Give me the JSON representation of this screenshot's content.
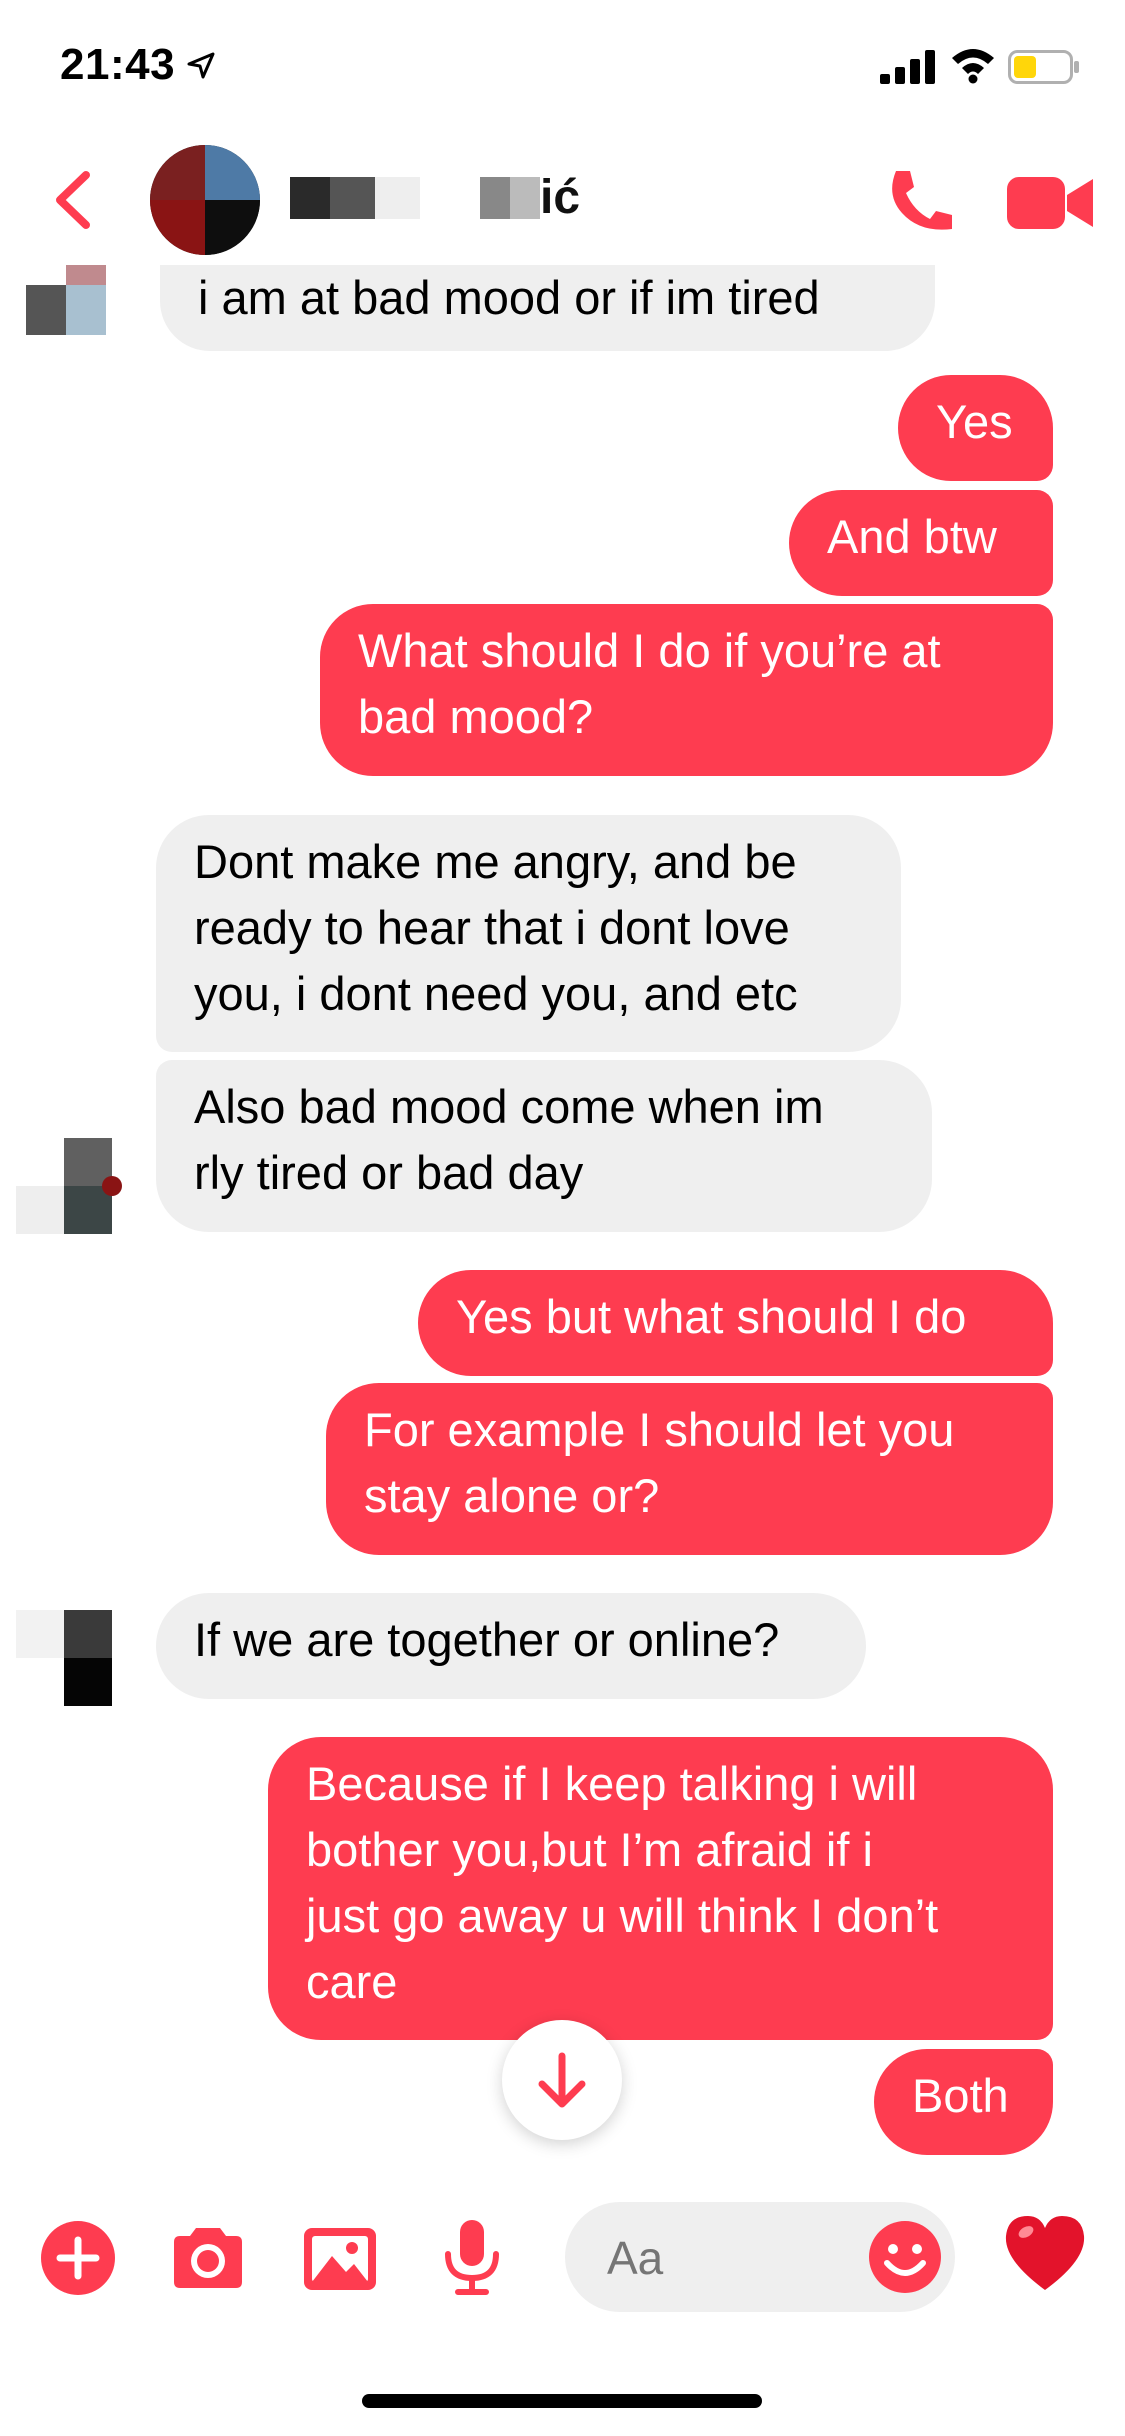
{
  "status_bar": {
    "time": "21:43",
    "location_icon": "location-arrow-icon",
    "signal_icon": "cellular-signal-icon",
    "wifi_icon": "wifi-icon",
    "battery_icon": "battery-low-icon",
    "battery_color": "#ffd60a"
  },
  "header": {
    "back_icon": "chevron-left-icon",
    "contact_name_visible": "M… …vić",
    "call_icon": "phone-icon",
    "video_icon": "video-camera-icon",
    "accent": "#fe3c50"
  },
  "messages": [
    {
      "side": "in",
      "text": "i am at bad mood or if im tired"
    },
    {
      "side": "out",
      "text": "Yes"
    },
    {
      "side": "out",
      "text": "And btw"
    },
    {
      "side": "out",
      "text": "What should I do if you’re at\nbad mood?"
    },
    {
      "side": "in",
      "text": "Dont make me angry, and be\nready to hear that i dont love\nyou, i dont need you, and etc"
    },
    {
      "side": "in",
      "text": "Also bad mood come when im\nrly tired or bad day"
    },
    {
      "side": "out",
      "text": "Yes but what should I do"
    },
    {
      "side": "out",
      "text": "For example I should let you\nstay alone or?"
    },
    {
      "side": "in",
      "text": "If we are together or online?"
    },
    {
      "side": "out",
      "text": "Because if I keep talking i will\nbother you,but I’m afraid if i\njust go away u will think I don’t\ncare"
    },
    {
      "side": "out",
      "text": "Both"
    }
  ],
  "scroll_down_icon": "arrow-down-icon",
  "composer": {
    "add_icon": "plus-circle-icon",
    "camera_icon": "camera-icon",
    "gallery_icon": "photo-icon",
    "mic_icon": "microphone-icon",
    "placeholder": "Aa",
    "emoji_icon": "smiley-icon",
    "like_icon": "heart-icon"
  },
  "colors": {
    "outgoing_bubble": "#fe3c50",
    "incoming_bubble": "#efefef"
  }
}
